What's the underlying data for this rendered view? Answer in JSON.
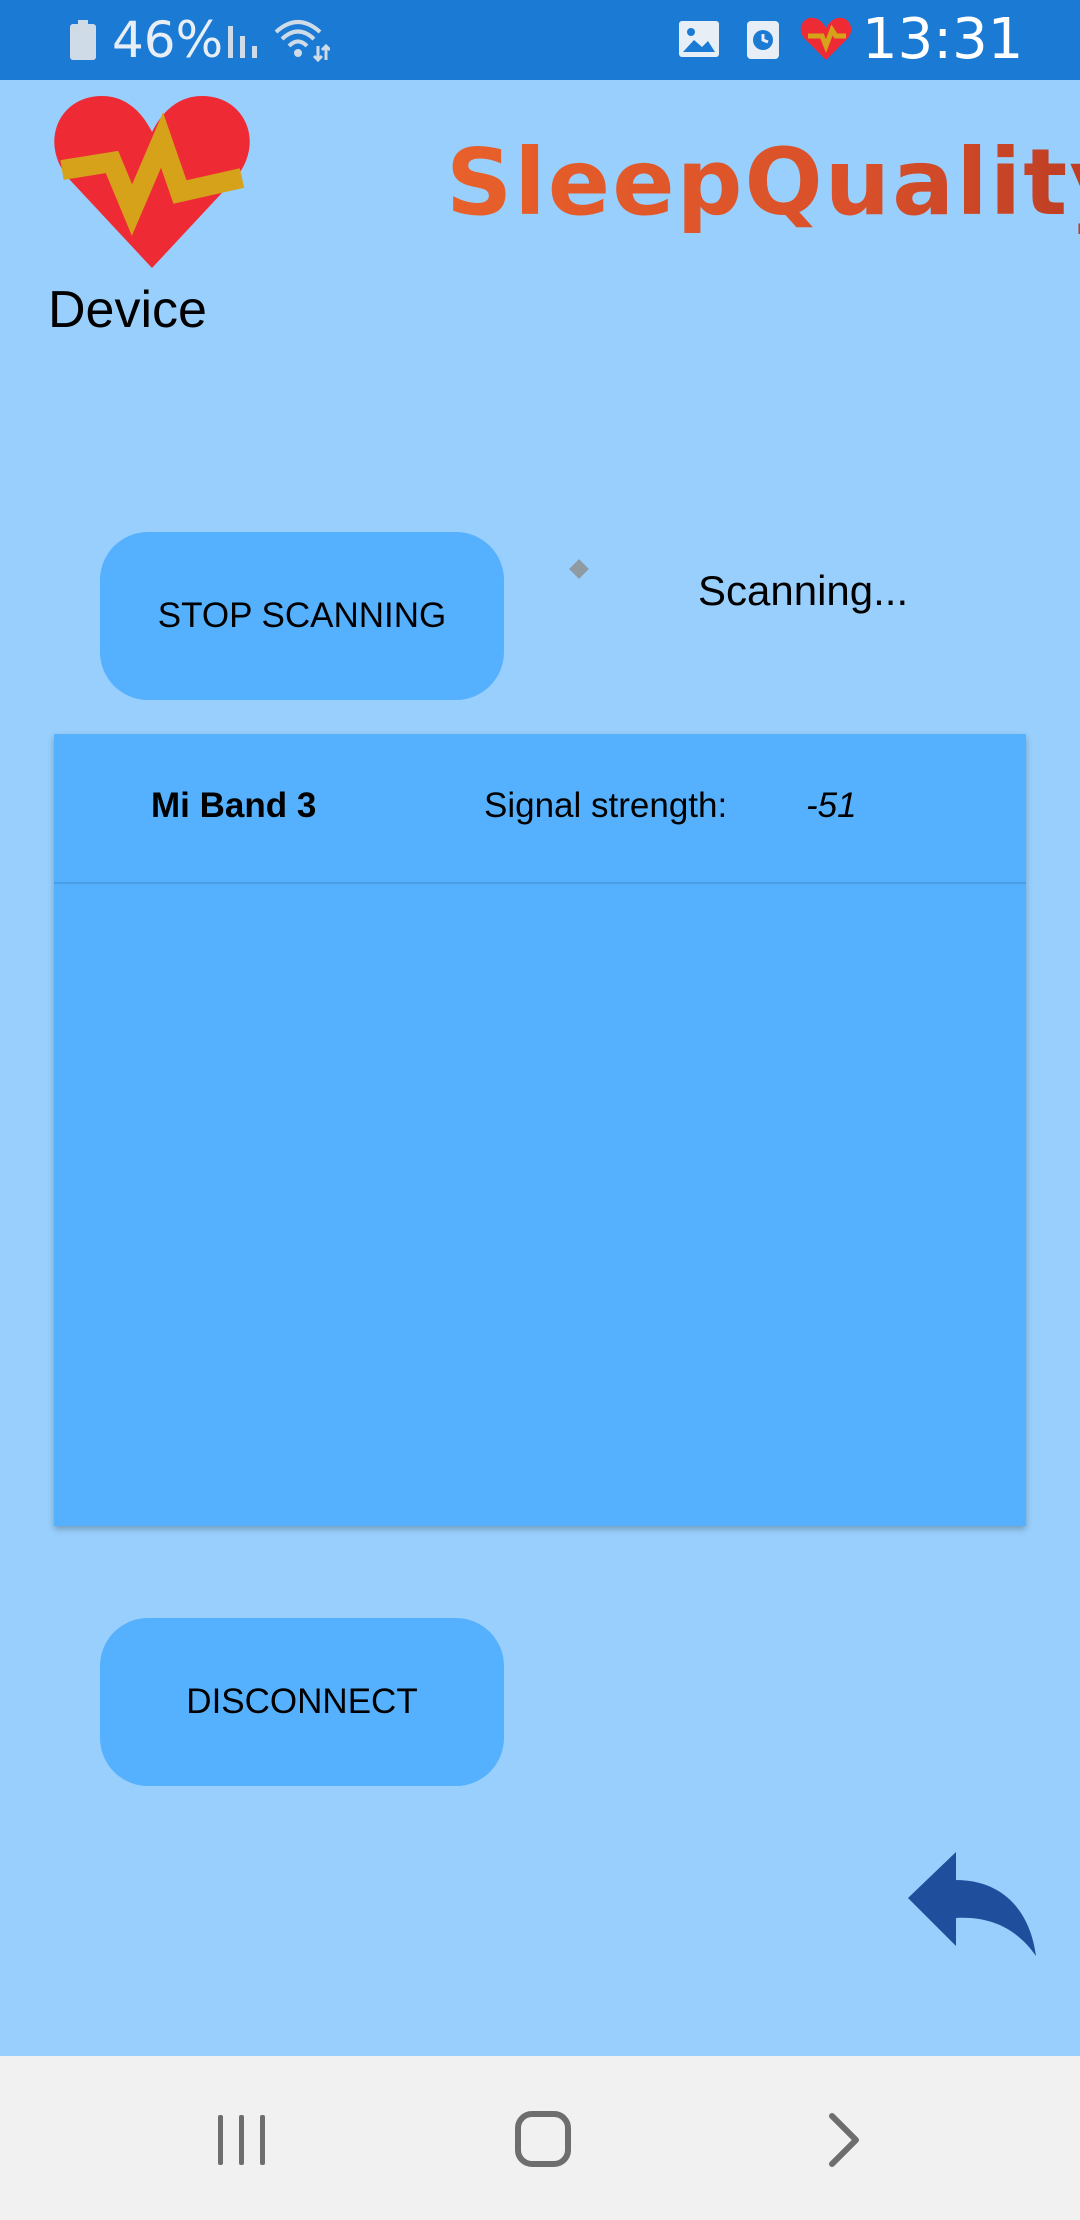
{
  "status_bar": {
    "battery": "46%",
    "time": "13:31",
    "icons": [
      "battery-icon",
      "signal-icon",
      "wifi-icon",
      "gallery-icon",
      "clock-icon",
      "app-heart-icon"
    ]
  },
  "header": {
    "app_name": "SleepQuality",
    "page_title": "Device",
    "logo_icon": "heart-logo-icon"
  },
  "scan": {
    "button_label": "STOP SCANNING",
    "status_text": "Scanning...",
    "spinner_icon": "spinner-icon"
  },
  "devices": [
    {
      "name": "Mi Band 3",
      "signal_label": "Signal strength:",
      "signal_value": "-51"
    }
  ],
  "actions": {
    "disconnect_label": "DISCONNECT",
    "back_icon": "undo-back-icon"
  },
  "navigation": {
    "icons": [
      "recents-icon",
      "home-icon",
      "back-icon"
    ]
  },
  "colors": {
    "background": "#99cffc",
    "status_bar": "#1a7ad4",
    "button": "#55b1fd",
    "list": "#55b1fd",
    "brand_orange": "#e05a2a",
    "heart_red": "#ee2b35",
    "back_arrow": "#1f4e9c",
    "nav_bar": "#f1f1f1"
  }
}
